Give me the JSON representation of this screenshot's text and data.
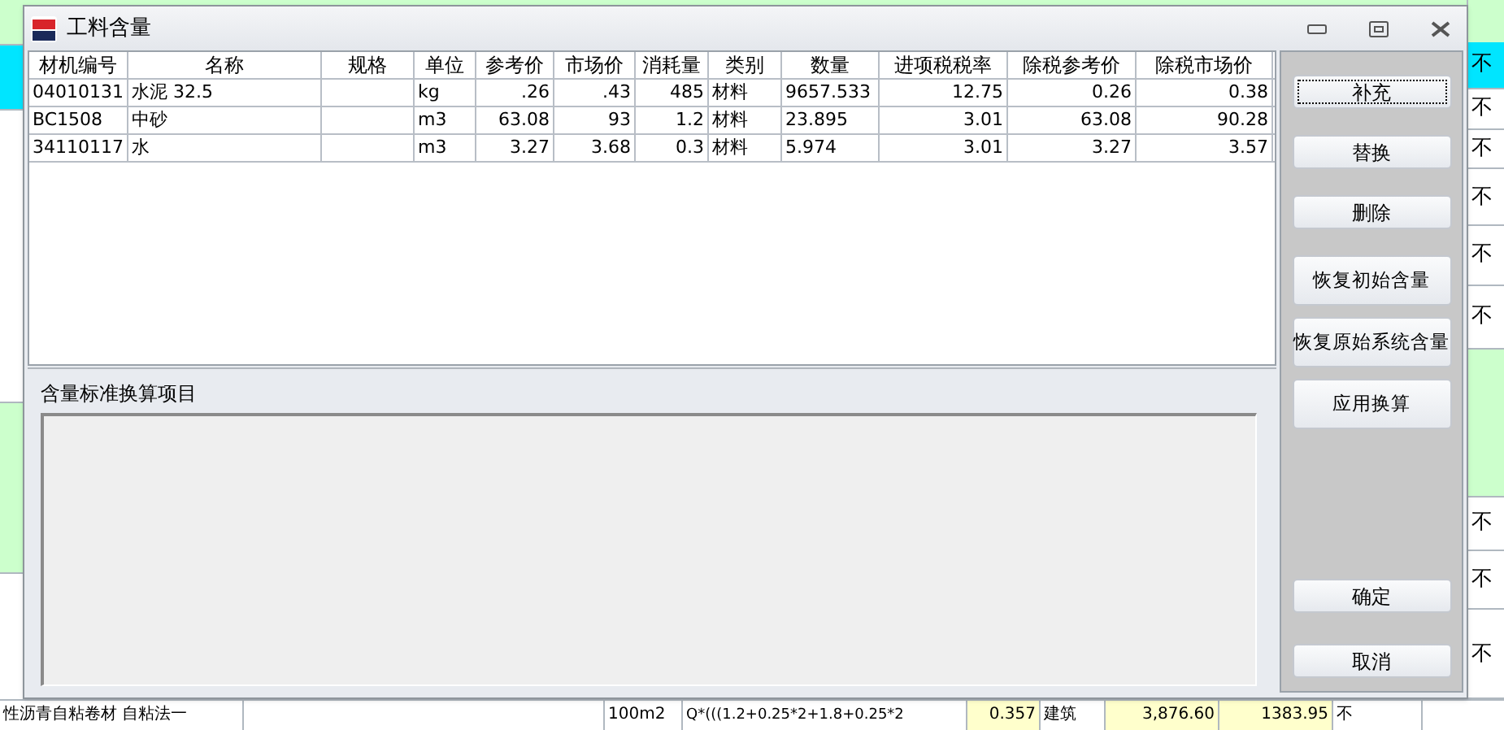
{
  "background": {
    "right_column": [
      {
        "kind": "selected",
        "text": "不"
      },
      {
        "kind": "plain",
        "text": "不"
      },
      {
        "kind": "plain",
        "text": "不"
      },
      {
        "kind": "plain",
        "text": "不"
      },
      {
        "kind": "plain",
        "text": "不"
      },
      {
        "kind": "plain",
        "text": "不"
      },
      {
        "kind": "group"
      },
      {
        "kind": "plain",
        "text": "不"
      },
      {
        "kind": "plain",
        "text": "不"
      },
      {
        "kind": "plain",
        "text": "不"
      }
    ],
    "bottom_row": [
      "性沥青自粘卷材 自粘法一",
      "100m2",
      "Q*(((1.2+0.25*2+1.8+0.25*2",
      "0.357",
      "建筑",
      "3,876.60",
      "1383.95",
      "不"
    ]
  },
  "window": {
    "title": "工料含量"
  },
  "table": {
    "columns": [
      {
        "label": "材机编号"
      },
      {
        "label": "名称"
      },
      {
        "label": "规格"
      },
      {
        "label": "单位"
      },
      {
        "label": "参考价"
      },
      {
        "label": "市场价"
      },
      {
        "label": "消耗量"
      },
      {
        "label": "类别"
      },
      {
        "label": "数量"
      },
      {
        "label": "进项税税率"
      },
      {
        "label": "除税参考价"
      },
      {
        "label": "除税市场价"
      }
    ],
    "rows": [
      [
        "04010131",
        "水泥 32.5",
        "",
        "kg",
        ".26",
        ".43",
        "485",
        "材料",
        "9657.533",
        "12.75",
        "0.26",
        "0.38"
      ],
      [
        "BC1508",
        "中砂",
        "",
        "m3",
        "63.08",
        "93",
        "1.2",
        "材料",
        "23.895",
        "3.01",
        "63.08",
        "90.28"
      ],
      [
        "34110117",
        "水",
        "",
        "m3",
        "3.27",
        "3.68",
        "0.3",
        "材料",
        "5.974",
        "3.01",
        "3.27",
        "3.57"
      ]
    ]
  },
  "conversion_panel": {
    "label": "含量标准换算项目"
  },
  "buttons": [
    {
      "label": "补充",
      "focused": true
    },
    {
      "label": "替换",
      "focused": false
    },
    {
      "label": "删除",
      "focused": false
    },
    {
      "label": "恢复初始含量",
      "focused": false
    },
    {
      "label": "恢复原始系统含量",
      "focused": false
    },
    {
      "label": "应用换算",
      "focused": false
    },
    {
      "label": "确定",
      "focused": false
    },
    {
      "label": "取消",
      "focused": false
    }
  ]
}
